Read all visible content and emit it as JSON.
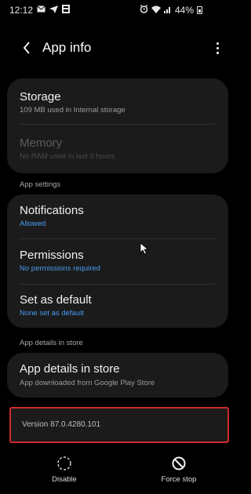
{
  "status_bar": {
    "time": "12:12",
    "battery": "44%",
    "icons": [
      "mail-icon",
      "send-icon",
      "sim-icon",
      "alarm-icon",
      "wifi-icon",
      "signal-icon",
      "battery-icon"
    ]
  },
  "app_bar": {
    "title": "App info",
    "back_icon": "chevron-left-icon",
    "more_icon": "more-vertical-icon"
  },
  "storage_section": {
    "storage": {
      "title": "Storage",
      "subtitle": "109 MB used in Internal storage"
    },
    "memory": {
      "title": "Memory",
      "subtitle": "No RAM used in last 3 hours"
    }
  },
  "app_settings": {
    "label": "App settings",
    "notifications": {
      "title": "Notifications",
      "subtitle": "Allowed"
    },
    "permissions": {
      "title": "Permissions",
      "subtitle": "No permissions required"
    },
    "set_as_default": {
      "title": "Set as default",
      "subtitle": "None set as default"
    }
  },
  "store_section": {
    "label": "App details in store",
    "item": {
      "title": "App details in store",
      "subtitle": "App downloaded from Google Play Store"
    }
  },
  "version": "Version 87.0.4280.101",
  "bottom_actions": {
    "disable": {
      "label": "Disable",
      "icon": "disable-icon"
    },
    "force_stop": {
      "label": "Force stop",
      "icon": "force-stop-icon"
    }
  },
  "colors": {
    "background": "#000000",
    "card": "#1b1b1b",
    "accent_blue": "#4a9bf0",
    "highlight_red": "#d22a2a"
  }
}
